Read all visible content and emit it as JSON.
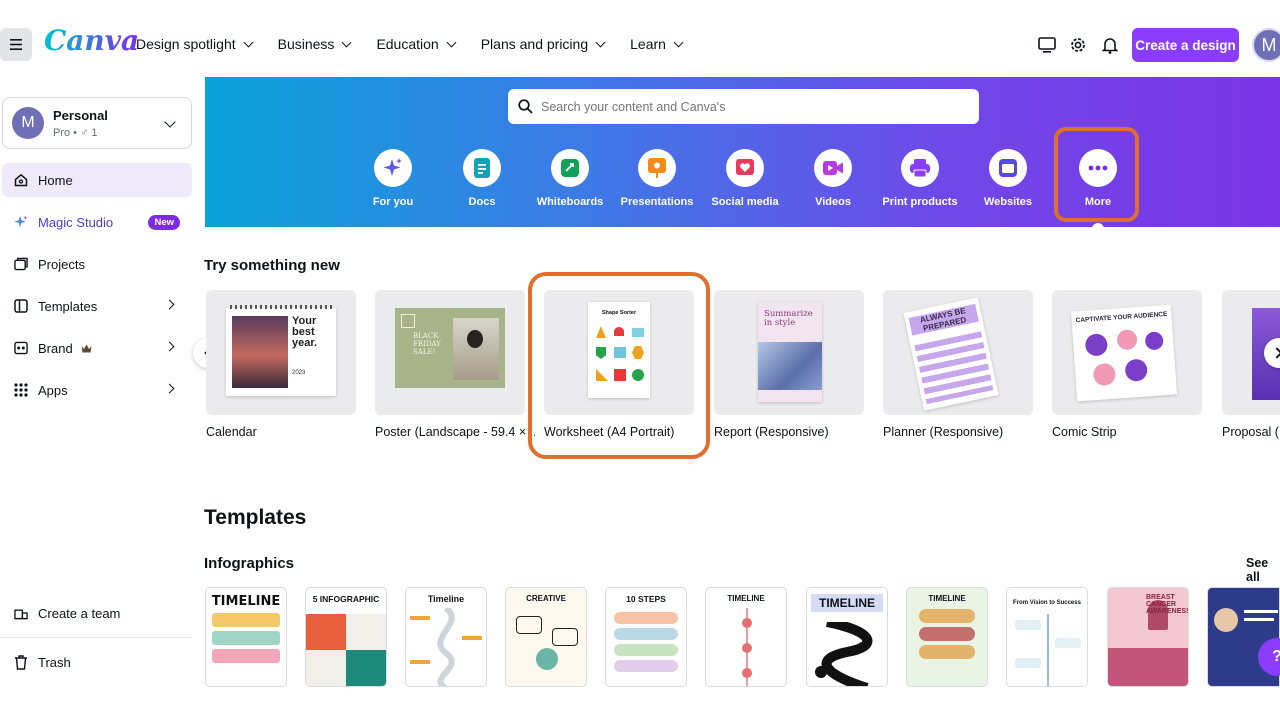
{
  "header": {
    "logo": "Canva",
    "nav": [
      "Design spotlight",
      "Business",
      "Education",
      "Plans and pricing",
      "Learn"
    ],
    "create_label": "Create a design",
    "avatar_letter": "M",
    "icons": [
      "monitor-icon",
      "gear-icon",
      "bell-icon"
    ]
  },
  "sidebar": {
    "account": {
      "avatar": "M",
      "name": "Personal",
      "sub": "Pro • ♂ 1"
    },
    "items": [
      {
        "label": "Home",
        "icon": "home-icon"
      },
      {
        "label": "Magic Studio",
        "icon": "sparkle-icon",
        "badge": "New"
      },
      {
        "label": "Projects",
        "icon": "folder-icon"
      },
      {
        "label": "Templates",
        "icon": "templates-icon"
      },
      {
        "label": "Brand",
        "icon": "brand-icon"
      },
      {
        "label": "Apps",
        "icon": "apps-icon"
      }
    ],
    "bottom": [
      {
        "label": "Create a team",
        "icon": "team-icon"
      },
      {
        "label": "Trash",
        "icon": "trash-icon"
      }
    ]
  },
  "hero": {
    "search_placeholder": "Search your content and Canva's",
    "categories": [
      {
        "label": "For you",
        "color": "#5b5ce2"
      },
      {
        "label": "Docs",
        "color": "#13a3b5"
      },
      {
        "label": "Whiteboards",
        "color": "#11a15a"
      },
      {
        "label": "Presentations",
        "color": "#f28a1c"
      },
      {
        "label": "Social media",
        "color": "#ea3a5c"
      },
      {
        "label": "Videos",
        "color": "#b53ce0"
      },
      {
        "label": "Print products",
        "color": "#8b3dff"
      },
      {
        "label": "Websites",
        "color": "#5a47e6"
      },
      {
        "label": "More",
        "color": "#7d2ae8"
      }
    ]
  },
  "try_new": {
    "title": "Try something new",
    "cards": [
      "Calendar",
      "Poster (Landscape - 59.4 × ...",
      "Worksheet (A4 Portrait)",
      "Report (Responsive)",
      "Planner (Responsive)",
      "Comic Strip",
      "Proposal (R"
    ],
    "calendar_text": "Your best year.",
    "calendar_year": "2023",
    "poster_text": "BLACK FRIDAY SALE!",
    "worksheet_title": "Shape Sorter",
    "report_text": "Summarize in style",
    "planner_text": "ALWAYS BE PREPARED",
    "comic_text": "CAPTIVATE YOUR AUDIENCE"
  },
  "templates": {
    "title": "Templates",
    "subtitle": "Infographics",
    "see_all": "See all",
    "cards": [
      {
        "title": "TIMELINE",
        "bg": "#ffffff"
      },
      {
        "title": "5 INFOGRAPHIC",
        "bg": "#ffffff"
      },
      {
        "title": "Timeline",
        "bg": "#ffffff"
      },
      {
        "title": "CREATIVE",
        "bg": "#fdf9ef"
      },
      {
        "title": "10 STEPS",
        "bg": "#ffffff"
      },
      {
        "title": "TIMELINE",
        "bg": "#ffffff"
      },
      {
        "title": "TIMELINE",
        "bg": "#ffffff"
      },
      {
        "title": "TIMELINE",
        "bg": "#e9f4e4"
      },
      {
        "title": "From Vision to Success",
        "bg": "#ffffff"
      },
      {
        "title": "BREAST CANCER AWARENESS",
        "bg": "#f3c8d2"
      },
      {
        "title": "",
        "bg": "#2e3a8a"
      }
    ]
  },
  "help": "?"
}
